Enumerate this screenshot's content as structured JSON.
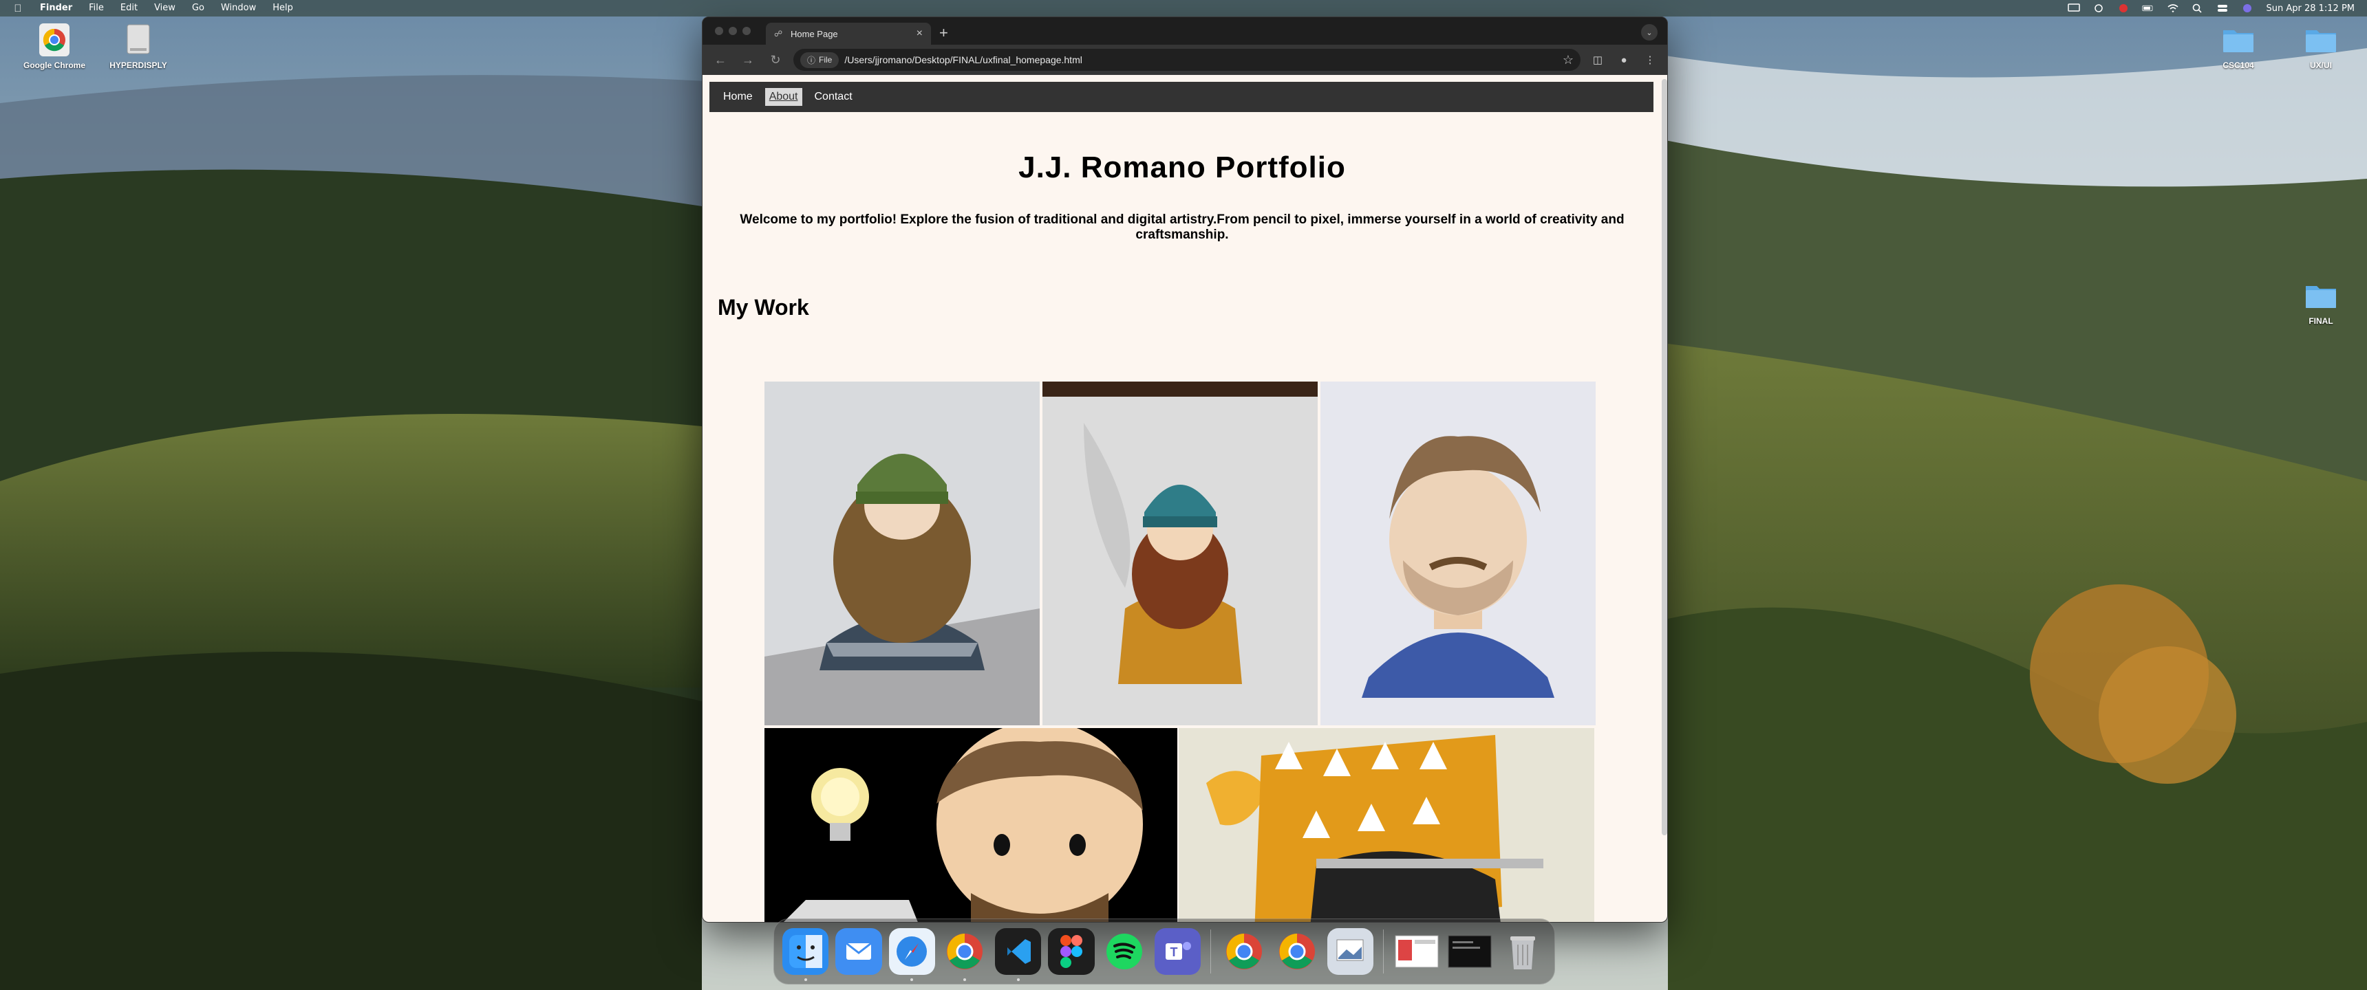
{
  "menubar": {
    "app_name": "Finder",
    "menus": [
      "File",
      "Edit",
      "View",
      "Go",
      "Window",
      "Help"
    ],
    "clock": "Sun Apr 28  1:12 PM"
  },
  "desktop_icons": [
    {
      "label": "Google Chrome",
      "icon": "chrome-icon"
    },
    {
      "label": "HYPERDISPLY",
      "icon": "drive-icon"
    },
    {
      "label": "CSC104",
      "icon": "folder-icon"
    },
    {
      "label": "UX/UI",
      "icon": "folder-icon"
    },
    {
      "label": "FINAL",
      "icon": "folder-icon"
    }
  ],
  "browser": {
    "tab_title": "Home Page",
    "new_tab_label": "+",
    "close_tab_label": "×",
    "omnibox_chip": "File",
    "url": "/Users/jjromano/Desktop/FINAL/uxfinal_homepage.html"
  },
  "page": {
    "nav": [
      "Home",
      "About",
      "Contact"
    ],
    "active_nav": "About",
    "title": "J.J. Romano Portfolio",
    "intro": "Welcome to my portfolio! Explore the fusion of traditional and digital artistry.From pencil to pixel, immerse yourself in a world of creativity and craftsmanship.",
    "section_heading": "My Work"
  },
  "gallery": [
    {
      "name": "bearded-man-green-beanie",
      "hat_color": "#5b7a3a",
      "beard_color": "#7a5a30",
      "bg": "#d7d9dc"
    },
    {
      "name": "bearded-man-teal-beanie",
      "hat_color": "#2f7d88",
      "beard_color": "#7c3a1c",
      "bg": "#dcdcdc"
    },
    {
      "name": "man-blue-hoodie",
      "hat_color": "#8a6a4a",
      "beard_color": "#7a5a3a",
      "bg": "#e6e7ee"
    },
    {
      "name": "digital-man-lightbulb",
      "hat_color": "#6a4a2a",
      "beard_color": "#6a4a2a",
      "bg": "#000000"
    },
    {
      "name": "warrior-yellow-robe",
      "hat_color": "#f0b030",
      "beard_color": "#e29a1a",
      "bg": "#e7e4d6"
    }
  ],
  "dock": [
    "finder",
    "mail",
    "safari",
    "chrome",
    "vscode",
    "figma",
    "spotify",
    "teams",
    "chrome-2",
    "chrome-3",
    "preview",
    "window-1",
    "window-2",
    "trash"
  ]
}
